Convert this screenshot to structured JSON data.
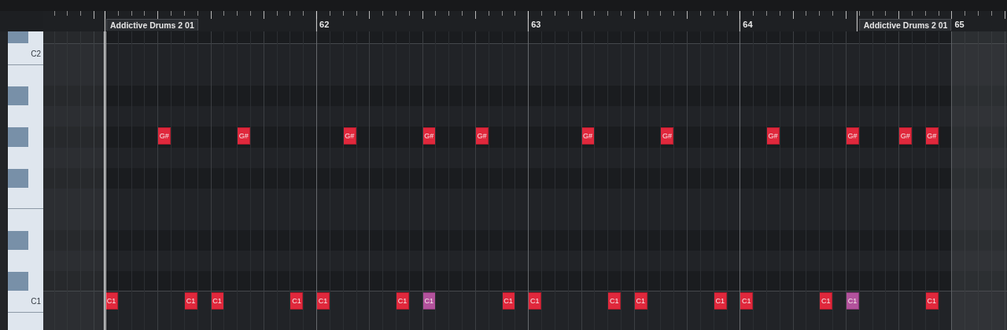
{
  "ruler": {
    "marks": [
      {
        "kind": "part",
        "text": "Addictive Drums 2 01"
      },
      {
        "kind": "bar",
        "text": "62"
      },
      {
        "kind": "bar",
        "text": "63"
      },
      {
        "kind": "bar",
        "text": "64"
      },
      {
        "kind": "part",
        "text": "Addictive Drums 2 01"
      },
      {
        "kind": "bar",
        "text": "65"
      }
    ]
  },
  "lanes": [
    {
      "kind": "black"
    },
    {
      "kind": "white",
      "key_label": "C2"
    },
    {
      "kind": "white"
    },
    {
      "kind": "black"
    },
    {
      "kind": "white"
    },
    {
      "kind": "black",
      "notes": [
        {
          "label": "G#",
          "selected": false
        },
        {
          "label": "G#",
          "selected": false
        },
        {
          "label": "G#",
          "selected": false
        },
        {
          "label": "G#",
          "selected": false
        },
        {
          "label": "G#",
          "selected": false
        },
        {
          "label": "G#",
          "selected": false
        },
        {
          "label": "G#",
          "selected": false
        },
        {
          "label": "G#",
          "selected": false
        },
        {
          "label": "G#",
          "selected": false
        },
        {
          "label": "G#",
          "selected": false
        },
        {
          "label": "G#",
          "selected": false
        }
      ]
    },
    {
      "kind": "white"
    },
    {
      "kind": "black"
    },
    {
      "kind": "white"
    },
    {
      "kind": "white"
    },
    {
      "kind": "black"
    },
    {
      "kind": "white"
    },
    {
      "kind": "black"
    },
    {
      "kind": "white",
      "key_label": "C1",
      "notes": [
        {
          "label": "C1",
          "selected": false
        },
        {
          "label": "C1",
          "selected": false
        },
        {
          "label": "C1",
          "selected": false
        },
        {
          "label": "C1",
          "selected": false
        },
        {
          "label": "C1",
          "selected": false
        },
        {
          "label": "C1",
          "selected": false
        },
        {
          "label": "C1",
          "selected": true
        },
        {
          "label": "C1",
          "selected": false
        },
        {
          "label": "C1",
          "selected": false
        },
        {
          "label": "C1",
          "selected": false
        },
        {
          "label": "C1",
          "selected": false
        },
        {
          "label": "C1",
          "selected": false
        },
        {
          "label": "C1",
          "selected": false
        },
        {
          "label": "C1",
          "selected": false
        },
        {
          "label": "C1",
          "selected": true
        },
        {
          "label": "C1",
          "selected": false
        }
      ]
    },
    {
      "kind": "white"
    }
  ]
}
